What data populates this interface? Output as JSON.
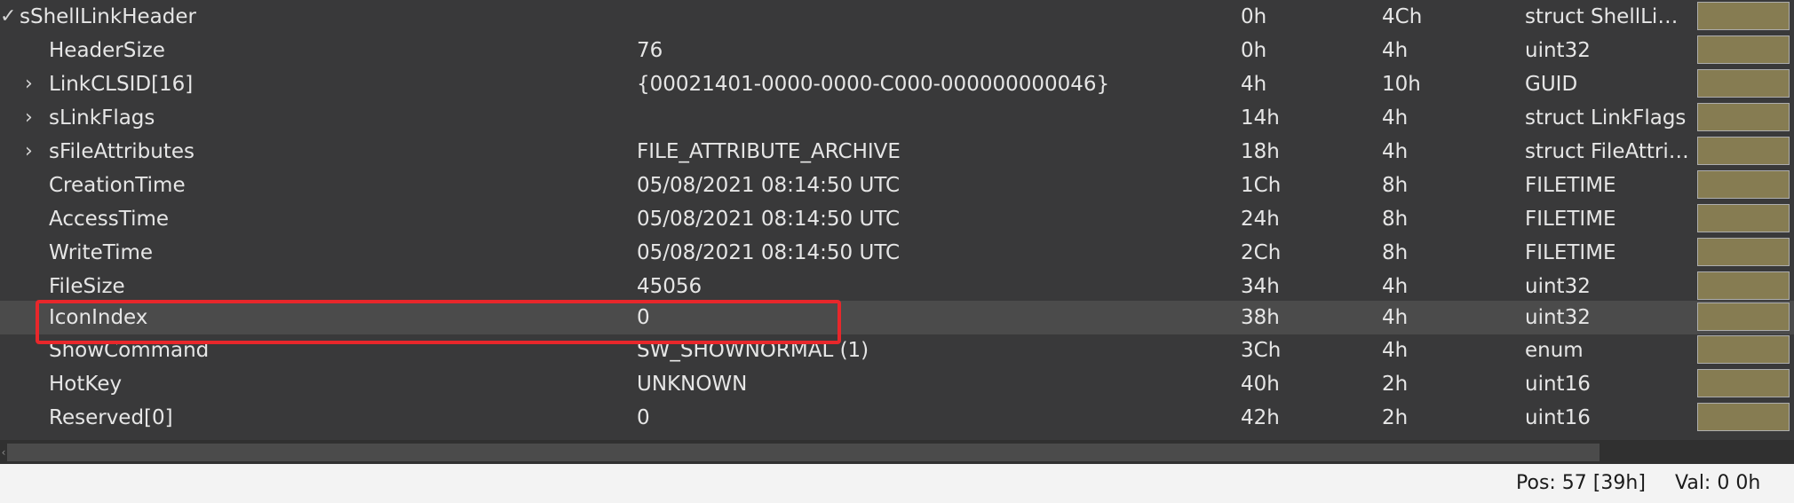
{
  "template_rows": [
    {
      "toggle": "✓",
      "name": "sShellLinkHeader",
      "value": "",
      "start": "0h",
      "size": "4Ch",
      "type": "struct ShellLin…",
      "selected": false,
      "highlighted": false
    },
    {
      "toggle": "",
      "name": "HeaderSize",
      "value": "76",
      "start": "0h",
      "size": "4h",
      "type": "uint32",
      "selected": false,
      "highlighted": false
    },
    {
      "toggle": "›",
      "name": "LinkCLSID[16]",
      "value": "{00021401-0000-0000-C000-000000000046}",
      "start": "4h",
      "size": "10h",
      "type": "GUID",
      "selected": false,
      "highlighted": false
    },
    {
      "toggle": "›",
      "name": "sLinkFlags",
      "value": "",
      "start": "14h",
      "size": "4h",
      "type": "struct LinkFlags",
      "selected": false,
      "highlighted": false
    },
    {
      "toggle": "›",
      "name": "sFileAttributes",
      "value": "FILE_ATTRIBUTE_ARCHIVE",
      "start": "18h",
      "size": "4h",
      "type": "struct FileAttri…",
      "selected": false,
      "highlighted": false
    },
    {
      "toggle": "",
      "name": "CreationTime",
      "value": "05/08/2021 08:14:50 UTC",
      "start": "1Ch",
      "size": "8h",
      "type": "FILETIME",
      "selected": false,
      "highlighted": false
    },
    {
      "toggle": "",
      "name": "AccessTime",
      "value": "05/08/2021 08:14:50 UTC",
      "start": "24h",
      "size": "8h",
      "type": "FILETIME",
      "selected": false,
      "highlighted": false
    },
    {
      "toggle": "",
      "name": "WriteTime",
      "value": "05/08/2021 08:14:50 UTC",
      "start": "2Ch",
      "size": "8h",
      "type": "FILETIME",
      "selected": false,
      "highlighted": false
    },
    {
      "toggle": "",
      "name": "FileSize",
      "value": "45056",
      "start": "34h",
      "size": "4h",
      "type": "uint32",
      "selected": false,
      "highlighted": false
    },
    {
      "toggle": "",
      "name": "IconIndex",
      "value": "0",
      "start": "38h",
      "size": "4h",
      "type": "uint32",
      "selected": true,
      "highlighted": true
    },
    {
      "toggle": "",
      "name": "ShowCommand",
      "value": "SW_SHOWNORMAL (1)",
      "start": "3Ch",
      "size": "4h",
      "type": "enum",
      "selected": false,
      "highlighted": false
    },
    {
      "toggle": "",
      "name": "HotKey",
      "value": "UNKNOWN",
      "start": "40h",
      "size": "2h",
      "type": "uint16",
      "selected": false,
      "highlighted": false
    },
    {
      "toggle": "",
      "name": "Reserved[0]",
      "value": "0",
      "start": "42h",
      "size": "2h",
      "type": "uint16",
      "selected": false,
      "highlighted": false
    }
  ],
  "status": {
    "position": "Pos: 57 [39h]",
    "value": "Val: 0 0h",
    "cut_off": ""
  },
  "colors": {
    "background": "#39393a",
    "selected_row": "#4b4b4b",
    "swatch": "#867c52",
    "highlight": "#e8272b",
    "statusbar": "#f3f3f3"
  }
}
